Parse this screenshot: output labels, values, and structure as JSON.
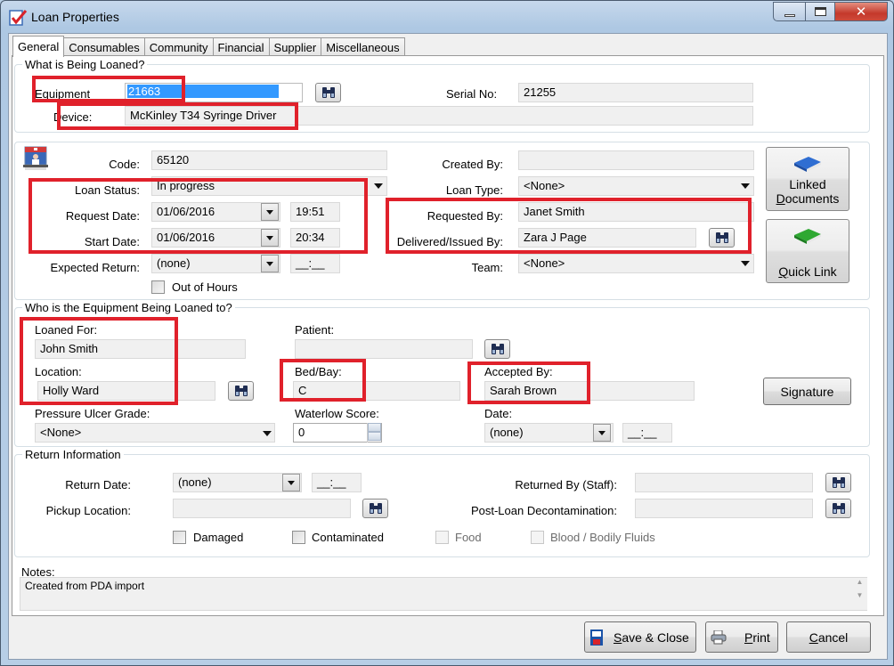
{
  "window": {
    "title": "Loan Properties",
    "controls": {
      "minimize": "—",
      "maximize": "☐",
      "close": "✕"
    }
  },
  "tabs": [
    {
      "label": "General",
      "active": true
    },
    {
      "label": "Consumables",
      "active": false
    },
    {
      "label": "Community",
      "active": false
    },
    {
      "label": "Financial",
      "active": false
    },
    {
      "label": "Supplier",
      "active": false
    },
    {
      "label": "Miscellaneous",
      "active": false
    }
  ],
  "what_loaned": {
    "title": "What is Being Loaned?",
    "equipment_label": "Equipment",
    "equipment_value": "21663",
    "serial_label": "Serial No:",
    "serial_value": "21255",
    "device_label": "Device:",
    "device_value": "McKinley T34 Syringe Driver"
  },
  "loan_details": {
    "code_label": "Code:",
    "code_value": "65120",
    "loan_status_label": "Loan Status:",
    "loan_status_value": "In progress",
    "request_date_label": "Request Date:",
    "request_date_value": "01/06/2016",
    "request_time_value": "19:51",
    "start_date_label": "Start Date:",
    "start_date_value": "01/06/2016",
    "start_time_value": "20:34",
    "expected_return_label": "Expected Return:",
    "expected_return_value": "(none)",
    "expected_return_time": "__:__",
    "out_of_hours_label": "Out of Hours",
    "out_of_hours_checked": false,
    "created_by_label": "Created By:",
    "created_by_value": "",
    "loan_type_label": "Loan Type:",
    "loan_type_value": "<None>",
    "requested_by_label": "Requested By:",
    "requested_by_value": "Janet Smith",
    "delivered_by_label": "Delivered/Issued By:",
    "delivered_by_value": "Zara J Page",
    "team_label": "Team:",
    "team_value": "<None>",
    "linked_documents_line1": "Linked",
    "linked_documents_line2_u": "D",
    "linked_documents_line2_rest": "ocuments",
    "quick_link_u": "Q",
    "quick_link_rest": "uick Link"
  },
  "loaned_to": {
    "title": "Who is the Equipment Being Loaned to?",
    "loaned_for_label": "Loaned For:",
    "loaned_for_value": "John Smith",
    "patient_label": "Patient:",
    "patient_value": "",
    "location_label": "Location:",
    "location_value": "Holly Ward",
    "bed_bay_label": "Bed/Bay:",
    "bed_bay_value": "C",
    "accepted_by_label": "Accepted By:",
    "accepted_by_value": "Sarah Brown",
    "signature_label": "Signature",
    "pressure_ulcer_label": "Pressure Ulcer Grade:",
    "pressure_ulcer_value": "<None>",
    "waterlow_label": "Waterlow Score:",
    "waterlow_value": "0",
    "date_label": "Date:",
    "date_value": "(none)",
    "time_value": "__:__"
  },
  "return_info": {
    "title": "Return Information",
    "return_date_label": "Return Date:",
    "return_date_value": "(none)",
    "return_time_value": "__:__",
    "pickup_location_label": "Pickup Location:",
    "pickup_location_value": "",
    "returned_by_label": "Returned By (Staff):",
    "returned_by_value": "",
    "decon_label": "Post-Loan Decontamination:",
    "decon_value": "",
    "checkboxes": [
      {
        "label": "Damaged",
        "checked": false,
        "enabled": true
      },
      {
        "label": "Contaminated",
        "checked": false,
        "enabled": true
      },
      {
        "label": "Food",
        "checked": false,
        "enabled": false
      },
      {
        "label": "Blood / Bodily Fluids",
        "checked": false,
        "enabled": false
      }
    ]
  },
  "notes": {
    "label": "Notes:",
    "value": "Created from PDA import"
  },
  "footer": {
    "save_u": "S",
    "save_rest": "ave & Close",
    "print_u": "P",
    "print_rest": "rint",
    "cancel_u": "C",
    "cancel_rest": "ancel"
  },
  "colors": {
    "annotation_red": "#e0212b",
    "selection_blue": "#3399ff",
    "close_red": "#c4392b"
  }
}
